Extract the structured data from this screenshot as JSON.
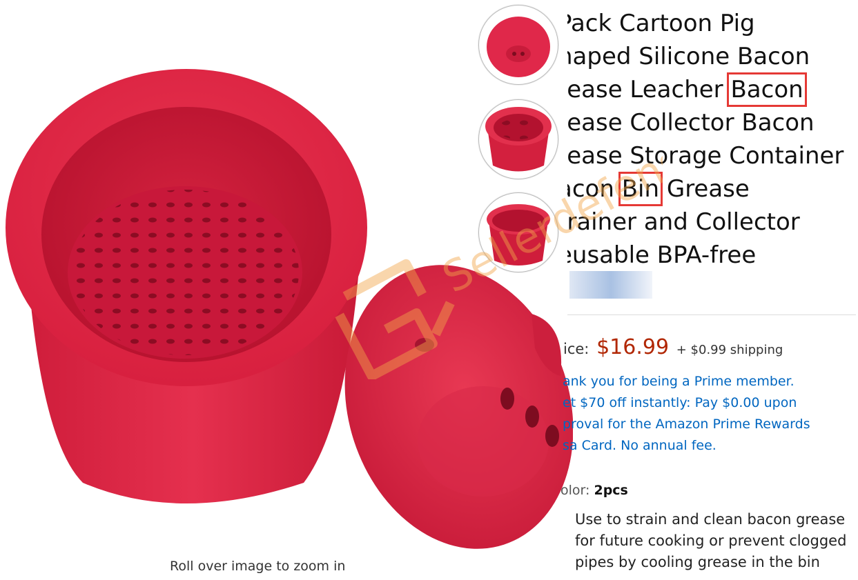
{
  "product": {
    "title_lines": [
      "Pack Cartoon Pig",
      "haped Silicone Bacon",
      "rease Leacher",
      "Bacon",
      "rease Collector Bacon",
      "rease Storage Container",
      "acon",
      "Bin",
      "Grease",
      "trainer and Collector",
      "eusable BPA-free"
    ],
    "price_label": "ice:",
    "price": "$16.99",
    "shipping": "+ $0.99 shipping",
    "prime_lines": [
      "ank you for being a Prime member.",
      "et $70 off instantly: Pay $0.00 upon",
      "proval for the Amazon Prime Rewards",
      "sa Card. No annual fee."
    ],
    "color_label": "olor:",
    "color_value": "2pcs",
    "description_lines": [
      "Use to strain and clean bacon grease",
      "for future cooking or prevent clogged",
      "pipes by cooling grease in the bin"
    ]
  },
  "gallery": {
    "zoom_hint": "Roll over image to zoom in",
    "thumbnails": [
      "pig-lid-thumbnail",
      "strainer-thumbnail",
      "container-thumbnail"
    ]
  },
  "watermark": {
    "text": "Sellerdefense"
  },
  "colors": {
    "product_red": "#e0284a",
    "price": "#b12704",
    "link": "#0066c0",
    "highlight": "#e53935"
  }
}
